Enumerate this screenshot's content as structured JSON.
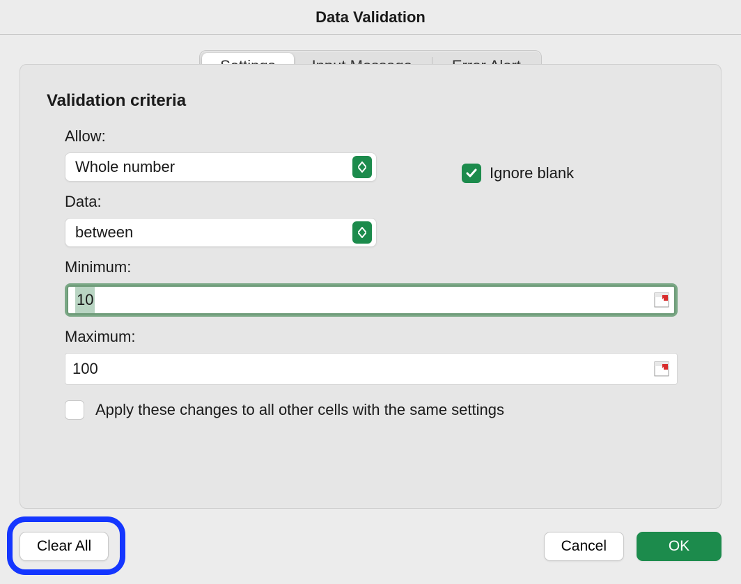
{
  "window": {
    "title": "Data Validation"
  },
  "tabs": {
    "settings": "Settings",
    "input_message": "Input Message",
    "error_alert": "Error Alert"
  },
  "section": {
    "title": "Validation criteria"
  },
  "form": {
    "allow_label": "Allow:",
    "allow_value": "Whole number",
    "ignore_blank_label": "Ignore blank",
    "ignore_blank_checked": true,
    "data_label": "Data:",
    "data_value": "between",
    "minimum_label": "Minimum:",
    "minimum_value": "10",
    "maximum_label": "Maximum:",
    "maximum_value": "100",
    "apply_label": "Apply these changes to all other cells with the same settings",
    "apply_checked": false
  },
  "buttons": {
    "clear_all": "Clear All",
    "cancel": "Cancel",
    "ok": "OK"
  }
}
